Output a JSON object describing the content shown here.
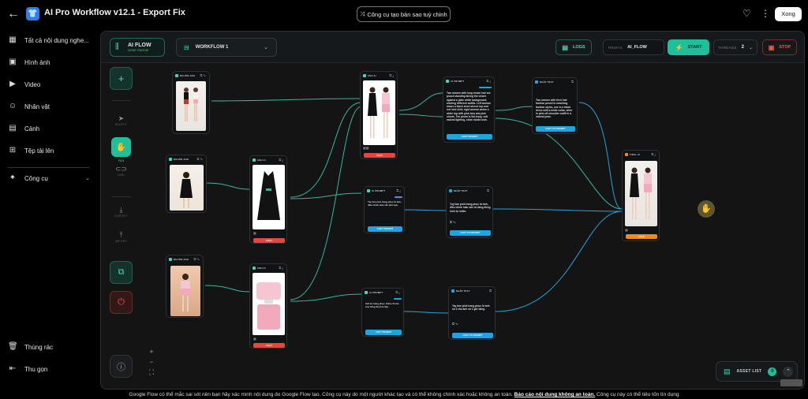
{
  "topbar": {
    "title": "AI Pro Workflow v12.1 - Export Fix",
    "copy_tool": "Công cụ tạo bản sao tuỳ chỉnh",
    "done": "Xong"
  },
  "sidebar": {
    "items": [
      {
        "label": "Tất cả nội dung nghe...",
        "icon": "grid-icon"
      },
      {
        "label": "Hình ảnh",
        "icon": "image-icon"
      },
      {
        "label": "Video",
        "icon": "video-icon"
      },
      {
        "label": "Nhân vật",
        "icon": "person-icon"
      },
      {
        "label": "Cảnh",
        "icon": "scene-icon"
      },
      {
        "label": "Tệp tải lên",
        "icon": "upload-folder-icon"
      },
      {
        "label": "Công cụ",
        "icon": "tools-icon"
      }
    ],
    "trash": "Thùng rác",
    "collapse": "Thu gọn"
  },
  "canvas": {
    "brand": {
      "title": "AI FLOW",
      "subtitle": "NODE ENGINE"
    },
    "workflow_select": "WORKFLOW 1",
    "logs": "LOGS",
    "prefix_label": "PREFIX",
    "prefix_value": "AI_FLOW",
    "start": "START",
    "threads_label": "THREADS",
    "threads_value": "2",
    "stop": "STOP",
    "tools": {
      "select": "SELECT",
      "pan": "PAN",
      "link": "LINK",
      "export": "EXPORT",
      "import": "IMPORT"
    },
    "asset_list": "ASSET LIST",
    "asset_count": "0"
  },
  "nodes": {
    "source_label": "NGUỒN ẢNH",
    "image_label": "ẢNH AI",
    "prompt_label": "AI PROMPT",
    "text_label": "NHẬP TEXT",
    "final_label": "FINAL AI",
    "copy_prompt": "COPY PROMPT",
    "copy_to_node": "COPY TO PROMPT",
    "run": "CHẠY",
    "save": "SAVE",
    "text_1": "Two women with long brown hair are posed standing facing the viewer against a plain white background, wearing different outfits. Left woman wears a black short-sleeve top and red mini skirt; right woman wears a white top with pink bow and pink shorts. The photo is full-body, soft natural lighting, clean studio look.",
    "text_2": "Two women with their hair fashion posed in matching fashion styles, one in a black dress with a white collar, other in pink off-shoulder outfit in a natural pose.",
    "text_3": "Tạy ban phối trang phục từ ảnh, điều chỉnh màu sắc phù hợp.",
    "text_4": "Tạy ban phối trang phục từ ảnh, điều chỉnh màu sắc và dáng đứng hình tự nhiên.",
    "text_5": "Tay ban phối trang phục từ ảnh số 2 vào ảnh số 1 giữ dáng.",
    "text_6": "Gửi bộ trang phục, thêm chi tiết hoa hồng để phối đẹp."
  },
  "footer": {
    "text": "Google Flow có thể mắc sai sót nên bạn hãy xác minh nội dung do Google Flow tạo. Công cụ này do một người khác tạo và có thể không chính xác hoặc không an toàn.",
    "link": "Báo cáo nội dung không an toàn.",
    "tail": "Công cụ này có thể tiêu tốn tín dụng"
  },
  "colors": {
    "accent": "#1fbf9c",
    "stop": "#ef5a44",
    "link_line": "#2fb9a0",
    "wire_blue": "#1ea5e0"
  }
}
